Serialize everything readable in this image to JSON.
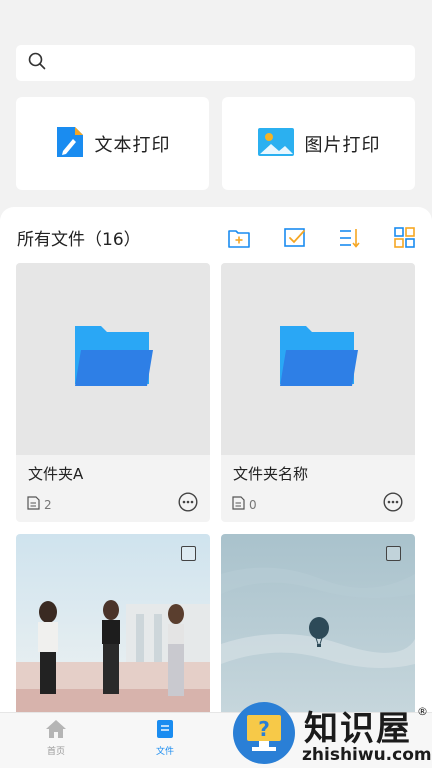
{
  "search": {
    "placeholder": "",
    "value": ""
  },
  "actions": {
    "text_print_label": "文本打印",
    "image_print_label": "图片打印"
  },
  "files": {
    "header": "所有文件（16）",
    "folders": [
      {
        "name": "文件夹A",
        "count": "2"
      },
      {
        "name": "文件夹名称",
        "count": "0"
      }
    ]
  },
  "tabs": [
    {
      "label": "首页",
      "active": false
    },
    {
      "label": "文件",
      "active": true
    }
  ],
  "watermark": {
    "cn": "知识屋",
    "en": "zhishiwu.com",
    "reg": "®"
  },
  "colors": {
    "accent": "#1a8cf0",
    "toolbar_orange": "#f5a623",
    "folder_blue": "#3a8ff0"
  }
}
